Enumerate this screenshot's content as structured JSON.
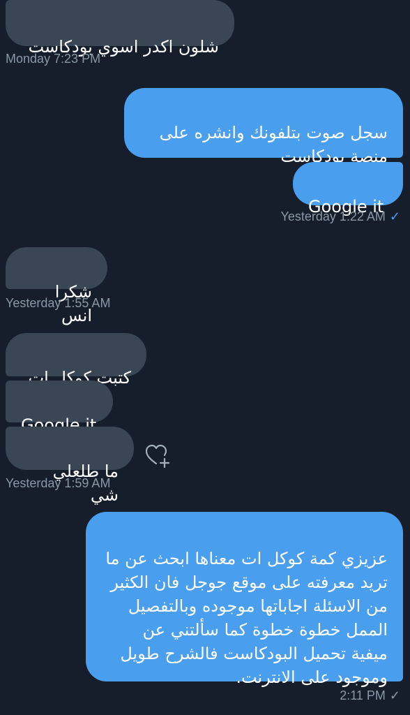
{
  "messages": [
    {
      "text": "شلون اكدر اسوي بودكاست"
    },
    {
      "text": "سجل صوت بتلفونك وانشره على منصة بودكاست"
    },
    {
      "text": "Google it"
    },
    {
      "text": "شكرا انس"
    },
    {
      "text": "كتبت كوكل ات"
    },
    {
      "text": "Google it"
    },
    {
      "text": "ما طلعلي شي"
    },
    {
      "text": "عزيزي كمة كوكل ات معناها ابحث عن ما تريد معرفته على موقع جوجل فان الكثير من الاسئلة اجاباتها موجوده وبالتفصيل الممل خطوة خطوة كما سألتني عن ميفية تحميل البودكاست فالشرح طويل وموجود على الانترنت."
    }
  ],
  "timestamps": {
    "t1": "Monday 7:23 PM",
    "t2": "Yesterday 1:22 AM",
    "t3": "Yesterday 1:55 AM",
    "t4": "Yesterday 1:59 AM",
    "t5": "2:11 PM"
  },
  "icons": {
    "sent_check": "✓",
    "heart_plus": "heart-plus-icon"
  },
  "colors": {
    "background": "#151e2a",
    "incoming_bubble": "#3a4654",
    "outgoing_bubble": "#4a9eee",
    "meta_text": "#8a97a5"
  }
}
